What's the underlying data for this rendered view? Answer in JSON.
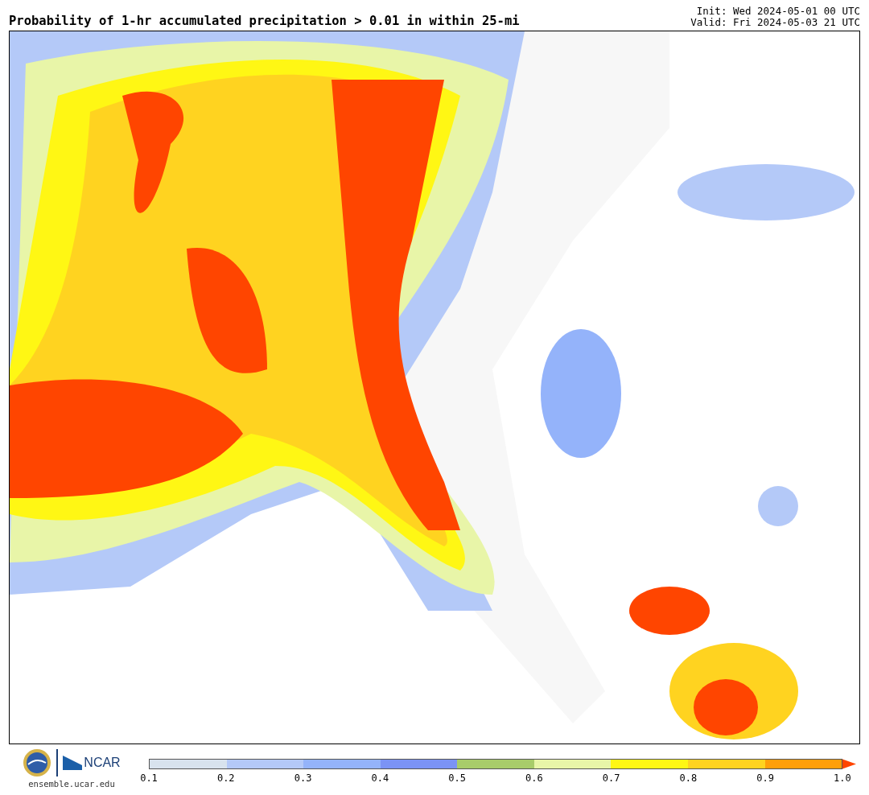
{
  "title": "Probability of 1-hr accumulated precipitation > 0.01 in within 25-mi",
  "init": "Init: Wed 2024-05-01 00 UTC",
  "valid": "Valid: Fri 2024-05-03 21 UTC",
  "ncar": "NCAR",
  "url": "ensemble.ucar.edu",
  "colorbar": {
    "bins": [
      {
        "kind": "band",
        "color": "#d8e3ee"
      },
      {
        "kind": "band",
        "color": "#b4c9f8"
      },
      {
        "kind": "band",
        "color": "#94b3fa"
      },
      {
        "kind": "band",
        "color": "#7b93f5"
      },
      {
        "kind": "band",
        "color": "#a8cc6a"
      },
      {
        "kind": "band",
        "color": "#e8f5a8"
      },
      {
        "kind": "band",
        "color": "#fff714"
      },
      {
        "kind": "band",
        "color": "#ffd320"
      },
      {
        "kind": "band",
        "color": "#ff9f0a"
      },
      {
        "kind": "arrow",
        "color": "#ff4500"
      }
    ],
    "ticks": [
      "0.1",
      "0.2",
      "0.3",
      "0.4",
      "0.5",
      "0.6",
      "0.7",
      "0.8",
      "0.9",
      "1.0"
    ]
  }
}
